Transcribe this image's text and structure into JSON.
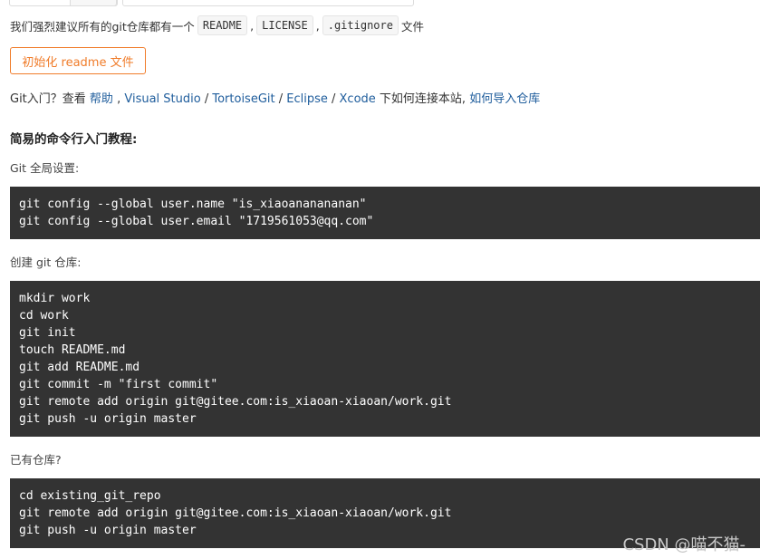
{
  "recommend": {
    "prefix": "我们强烈建议所有的git仓库都有一个",
    "tags": [
      "README",
      "LICENSE",
      ".gitignore"
    ],
    "sep": ",",
    "suffix": "文件"
  },
  "init_button_label": "初始化 readme 文件",
  "help": {
    "prefix": "Git入门？查看 ",
    "link_help": "帮助",
    "sep1": " , ",
    "link_vs": "Visual Studio",
    "slash1": " / ",
    "link_tortoise": "TortoiseGit",
    "slash2": " / ",
    "link_eclipse": "Eclipse",
    "slash3": " / ",
    "link_xcode": "Xcode",
    "middle": " 下如何连接本站, ",
    "link_import": "如何导入仓库"
  },
  "section_title": "简易的命令行入门教程:",
  "global_label": "Git 全局设置:",
  "global_code": [
    "git config --global user.name \"is_xiaoananananan\"",
    "git config --global user.email \"1719561053@qq.com\""
  ],
  "create_label": "创建 git 仓库:",
  "create_code": [
    "mkdir work",
    "cd work",
    "git init",
    "touch README.md",
    "git add README.md",
    "git commit -m \"first commit\"",
    "git remote add origin git@gitee.com:is_xiaoan-xiaoan/work.git",
    "git push -u origin master"
  ],
  "existing_label": "已有仓库?",
  "existing_code": [
    "cd existing_git_repo",
    "git remote add origin git@gitee.com:is_xiaoan-xiaoan/work.git",
    "git push -u origin master"
  ],
  "watermark": "CSDN @喵不猫-"
}
